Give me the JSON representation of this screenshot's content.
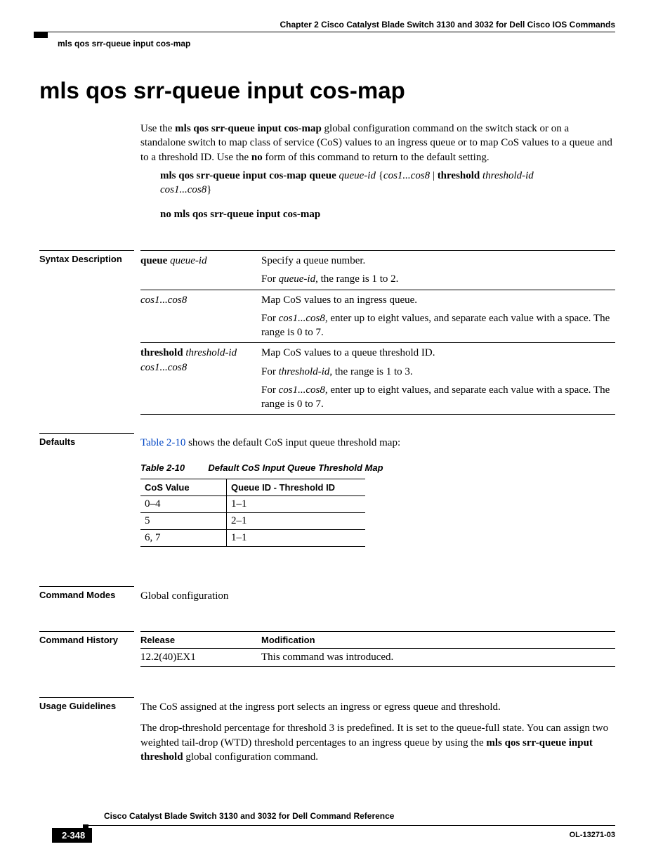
{
  "header": {
    "chapter": "Chapter 2      Cisco Catalyst Blade Switch 3130 and 3032 for Dell Cisco IOS Commands",
    "crumb": "mls qos srr-queue input cos-map"
  },
  "title": "mls qos srr-queue input cos-map",
  "intro": {
    "p1_a": "Use the ",
    "p1_b": "mls qos srr-queue input cos-map",
    "p1_c": " global configuration command on the switch stack or on a standalone switch to map class of service (CoS) values to an ingress queue or to map CoS values to a queue and to a threshold ID. Use the ",
    "p1_d": "no",
    "p1_e": " form of this command to return to the default setting."
  },
  "syntax_cmd": {
    "l1_a": "mls qos srr-queue input cos-map queue ",
    "l1_b": "queue-id",
    "l1_c": " {",
    "l1_d": "cos1...cos8",
    "l1_e": " | ",
    "l1_f": "threshold",
    "l1_g": " ",
    "l1_h": "threshold-id",
    "l2_a": "cos1...cos8",
    "l2_b": "}",
    "no": "no mls qos srr-queue input cos-map"
  },
  "labels": {
    "syntax": "Syntax Description",
    "defaults": "Defaults",
    "modes": "Command Modes",
    "history": "Command History",
    "usage": "Usage Guidelines"
  },
  "syntax_table": {
    "r1c1_a": "queue ",
    "r1c1_b": "queue-id",
    "r1c2_a": "Specify a queue number.",
    "r1c2_b1": "For ",
    "r1c2_b2": "queue-id",
    "r1c2_b3": ", the range is 1 to 2.",
    "r2c1": "cos1...cos8",
    "r2c2_a": "Map CoS values to an ingress queue.",
    "r2c2_b1": "For ",
    "r2c2_b2": "cos1...cos8",
    "r2c2_b3": ", enter up to eight values, and separate each value with a space. The range is 0 to 7.",
    "r3c1_a": "threshold ",
    "r3c1_b": "threshold-id",
    "r3c1_c": "cos1...cos8",
    "r3c2_a": "Map CoS values to a queue threshold ID.",
    "r3c2_b1": "For ",
    "r3c2_b2": "threshold-id",
    "r3c2_b3": ", the range is 1 to 3.",
    "r3c2_c1": "For ",
    "r3c2_c2": "cos1...cos8",
    "r3c2_c3": ", enter up to eight values, and separate each value with a space. The range is 0 to 7."
  },
  "defaults": {
    "p_a": "Table 2-10",
    "p_b": " shows the default CoS input queue threshold map:",
    "caption_a": "Table 2-10",
    "caption_b": "Default CoS Input Queue Threshold Map",
    "h1": "CoS Value",
    "h2": "Queue ID - Threshold ID",
    "rows": [
      {
        "c1": "0–4",
        "c2": "1–1"
      },
      {
        "c1": "5",
        "c2": "2–1"
      },
      {
        "c1": "6, 7",
        "c2": "1–1"
      }
    ]
  },
  "modes": "Global configuration",
  "history": {
    "h1": "Release",
    "h2": "Modification",
    "r1c1": "12.2(40)EX1",
    "r1c2": "This command was introduced."
  },
  "usage": {
    "p1": "The CoS assigned at the ingress port selects an ingress or egress queue and threshold.",
    "p2_a": "The drop-threshold percentage for threshold 3 is predefined. It is set to the queue-full state. You can assign two weighted tail-drop (WTD) threshold percentages to an ingress queue by using the ",
    "p2_b": "mls qos srr-queue input threshold",
    "p2_c": " global configuration command."
  },
  "footer": {
    "title": "Cisco Catalyst Blade Switch 3130 and 3032 for Dell Command Reference",
    "page": "2-348",
    "doc": "OL-13271-03"
  }
}
